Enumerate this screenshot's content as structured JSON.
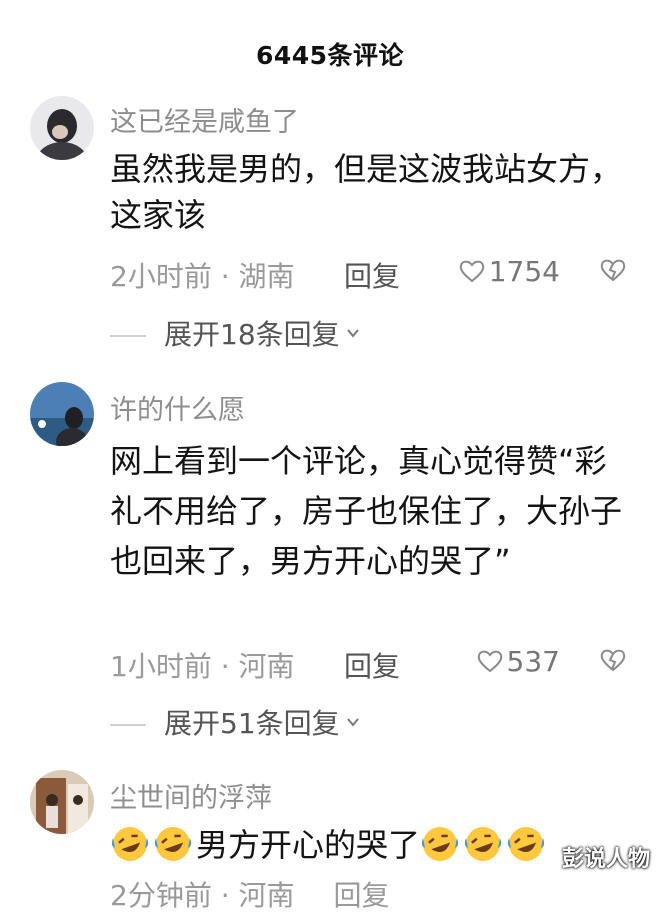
{
  "header": {
    "title": "6445条评论"
  },
  "comments": [
    {
      "username": "这已经是咸鱼了",
      "text": "虽然我是男的，但是这波我站女方，这家该",
      "time_location": "2小时前 · 湖南",
      "reply_label": "回复",
      "likes": "1754",
      "expand_label": "展开18条回复"
    },
    {
      "username": "许的什么愿",
      "text": "网上看到一个评论，真心觉得赞“彩礼不用给了，房子也保住了，大孙子也回来了，男方开心的哭了”",
      "time_location": "1小时前 · 河南",
      "reply_label": "回复",
      "likes": "537",
      "expand_label": "展开51条回复"
    },
    {
      "username": "尘世间的浮萍",
      "text": "男方开心的哭了",
      "time_location": "2分钟前 · 河南",
      "reply_label": "回复"
    }
  ],
  "icons": {
    "like": "heart-outline-icon",
    "dislike": "broken-heart-icon",
    "expand": "chevron-down-icon",
    "emoji": "rofl-emoji-icon"
  },
  "watermark": "彭说人物",
  "colors": {
    "username": "#8e8e8e",
    "meta": "#9a9a9a",
    "emoji_face": "#ffc83d",
    "emoji_tear": "#3b9ae1"
  }
}
